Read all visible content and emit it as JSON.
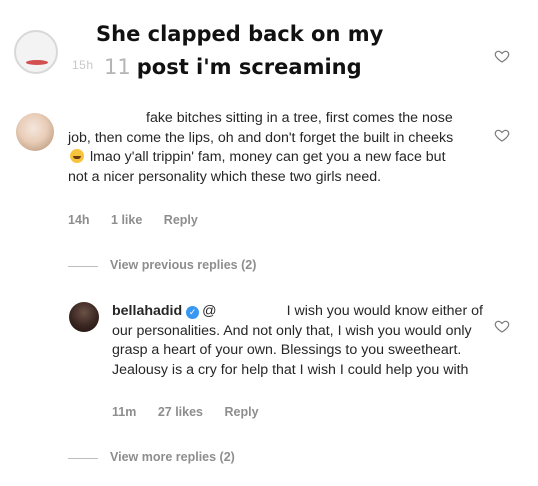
{
  "overlay": {
    "line1": "She clapped back on my",
    "line2_tick": "11",
    "line2": "post i'm screaming"
  },
  "top_comment": {
    "meta_partial": "15h"
  },
  "comment1": {
    "text_part1": "fake bitches sitting in a tree, first comes the nose job, then come the lips, oh and don't forget the built in cheeks",
    "text_part2": "lmao y'all trippin' fam, money can get you a new face but not a nicer personality which these two girls need.",
    "emoji_icon": "laughing-tears-emoji",
    "time": "14h",
    "likes": "1 like",
    "reply": "Reply"
  },
  "view_previous": "View previous replies (2)",
  "reply1": {
    "username": "bellahadid",
    "mention": "@",
    "text": "I wish you would know either of our personalities. And not only that, I wish you would only grasp a heart of your own. Blessings to you sweetheart. Jealousy is a cry for help that I wish I could help you with",
    "time": "11m",
    "likes": "27 likes",
    "reply": "Reply"
  },
  "view_more": "View more replies (2)",
  "colors": {
    "text": "#262626",
    "meta": "#8e8e8e",
    "verified": "#3897f0"
  }
}
